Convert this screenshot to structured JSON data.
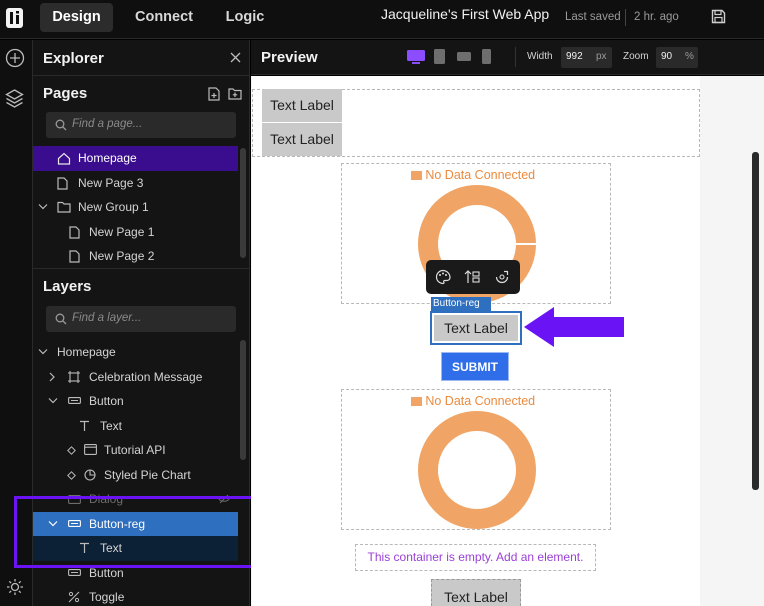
{
  "topbar": {
    "tabs": [
      {
        "label": "Design"
      },
      {
        "label": "Connect"
      },
      {
        "label": "Logic"
      }
    ],
    "app_title": "Jacqueline's First Web App",
    "last_saved_label": "Last saved",
    "last_saved_time": "2 hr. ago"
  },
  "explorer": {
    "title": "Explorer",
    "pages": {
      "title": "Pages",
      "search_placeholder": "Find a page...",
      "items": [
        {
          "label": "Homepage"
        },
        {
          "label": "New Page 3"
        },
        {
          "label": "New Group 1"
        },
        {
          "label": "New Page 1"
        },
        {
          "label": "New Page 2"
        }
      ]
    },
    "layers": {
      "title": "Layers",
      "search_placeholder": "Find a layer...",
      "items": [
        {
          "label": "Homepage"
        },
        {
          "label": "Celebration Message"
        },
        {
          "label": "Button"
        },
        {
          "label": "Text"
        },
        {
          "label": "Tutorial API"
        },
        {
          "label": "Styled Pie Chart"
        },
        {
          "label": "Dialog"
        },
        {
          "label": "Button-reg"
        },
        {
          "label": "Text"
        },
        {
          "label": "Button"
        },
        {
          "label": "Toggle"
        }
      ]
    }
  },
  "preview": {
    "title": "Preview",
    "width_label": "Width",
    "width_value": "992",
    "width_unit": "px",
    "zoom_label": "Zoom",
    "zoom_value": "90",
    "zoom_unit": "%"
  },
  "canvas": {
    "text_label_1": "Text Label",
    "text_label_2": "Text Label",
    "chart1_msg": "No Data Connected",
    "selected_tag": "Button-reg",
    "selected_button": "Text Label",
    "submit": "SUBMIT",
    "chart2_msg": "No Data Connected",
    "empty_msg": "This container is empty. Add an element.",
    "text_label_3": "Text Label"
  },
  "colors": {
    "accent": "#6a14f5",
    "selection": "#2f6fbf",
    "submit": "#2f6ee8",
    "donut": "#f0a465",
    "page_highlight": "#3a0d8f"
  }
}
